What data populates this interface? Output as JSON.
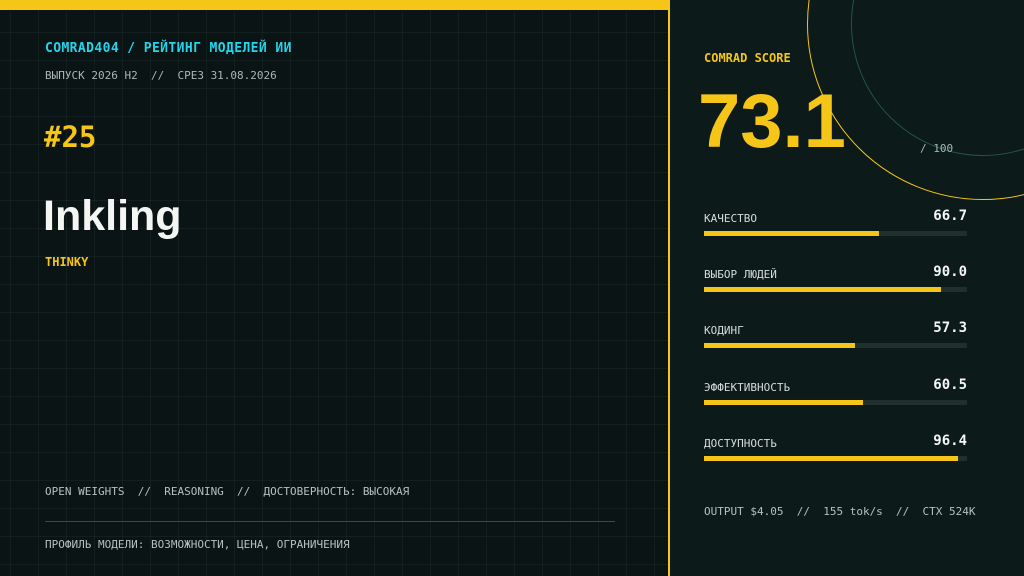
{
  "header": {
    "brand": "COMRAD404 / РЕЙТИНГ МОДЕЛЕЙ ИИ",
    "issue": "ВЫПУСК 2026 H2  //  СРЕЗ 31.08.2026"
  },
  "model": {
    "rank": "#25",
    "name": "Inkling",
    "vendor": "THINKY",
    "tags": "OPEN WEIGHTS  //  REASONING  //  ДОСТОВЕРНОСТЬ: ВЫСОКАЯ",
    "profile": "ПРОФИЛЬ МОДЕЛИ: ВОЗМОЖНОСТИ, ЦЕНА, ОГРАНИЧЕНИЯ"
  },
  "score": {
    "label": "COMRAD SCORE",
    "value": "73.1",
    "max": "/ 100"
  },
  "metrics": [
    {
      "name": "КАЧЕСТВО",
      "value": "66.7",
      "fraction": 0.667
    },
    {
      "name": "ВЫБОР ЛЮДЕЙ",
      "value": "90.0",
      "fraction": 0.9
    },
    {
      "name": "КОДИНГ",
      "value": "57.3",
      "fraction": 0.573
    },
    {
      "name": "ЭФФЕКТИВНОСТЬ",
      "value": "60.5",
      "fraction": 0.605
    },
    {
      "name": "ДОСТУПНОСТЬ",
      "value": "96.4",
      "fraction": 0.964
    }
  ],
  "footer": "OUTPUT $4.05  //  155 tok/s  //  CTX 524K",
  "colors": {
    "accent": "#f5c518",
    "brand": "#26d4ea",
    "background": "#0b1414",
    "panel": "#0c1a19"
  }
}
